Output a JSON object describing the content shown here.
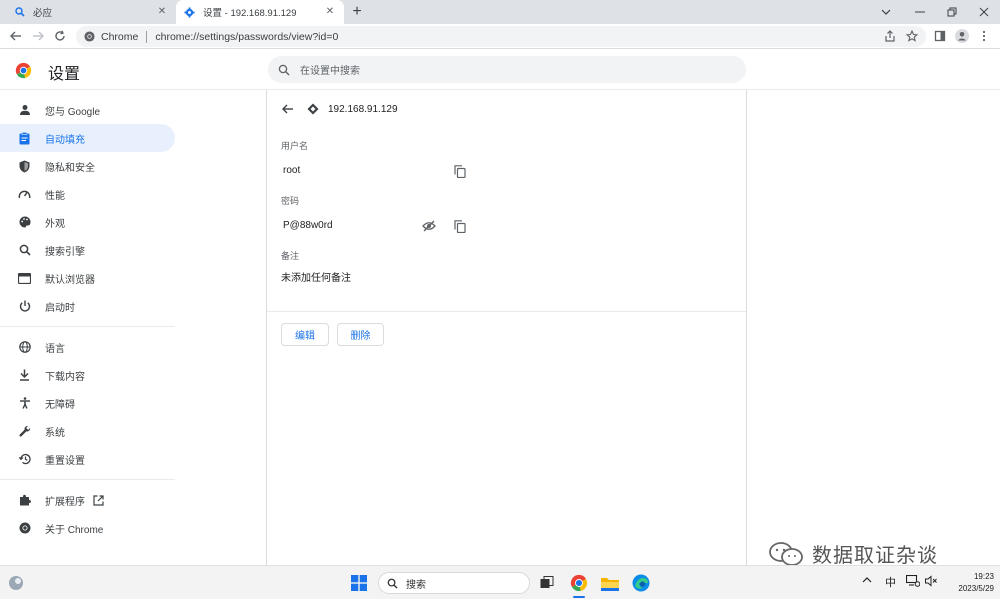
{
  "tabs": [
    {
      "title": "必应",
      "icon": "bing-search-icon"
    },
    {
      "title": "设置 - 192.168.91.129",
      "icon": "gear-icon"
    }
  ],
  "toolbar": {
    "chip_label": "Chrome",
    "url": "chrome://settings/passwords/view?id=0"
  },
  "header": {
    "title": "设置",
    "search_placeholder": "在设置中搜索"
  },
  "sidebar": {
    "items": [
      {
        "label": "您与 Google",
        "icon": "person-icon"
      },
      {
        "label": "自动填充",
        "icon": "clipboard-icon",
        "active": true
      },
      {
        "label": "隐私和安全",
        "icon": "shield-icon"
      },
      {
        "label": "性能",
        "icon": "speedometer-icon"
      },
      {
        "label": "外观",
        "icon": "palette-icon"
      },
      {
        "label": "搜索引擎",
        "icon": "search-icon"
      },
      {
        "label": "默认浏览器",
        "icon": "browser-window-icon"
      },
      {
        "label": "启动时",
        "icon": "power-icon"
      },
      {
        "label": "语言",
        "icon": "globe-icon"
      },
      {
        "label": "下载内容",
        "icon": "download-icon"
      },
      {
        "label": "无障碍",
        "icon": "accessibility-icon"
      },
      {
        "label": "系统",
        "icon": "wrench-icon"
      },
      {
        "label": "重置设置",
        "icon": "restore-icon"
      },
      {
        "label": "扩展程序",
        "icon": "puzzle-icon"
      },
      {
        "label": "关于 Chrome",
        "icon": "chrome-icon"
      }
    ]
  },
  "password_detail": {
    "site": "192.168.91.129",
    "username_label": "用户名",
    "username_value": "root",
    "password_label": "密码",
    "password_value": "P@88w0rd",
    "note_label": "备注",
    "note_value": "未添加任何备注",
    "edit_label": "编辑",
    "delete_label": "删除"
  },
  "watermark": {
    "text": "数据取证杂谈"
  },
  "taskbar": {
    "search_label": "搜索",
    "ime_label": "中",
    "time": "19:23",
    "date": "2023/5/29"
  },
  "colors": {
    "accent": "#1a73e8",
    "active_bg": "#e8f0fe",
    "tabstrip": "#dee1e6"
  }
}
